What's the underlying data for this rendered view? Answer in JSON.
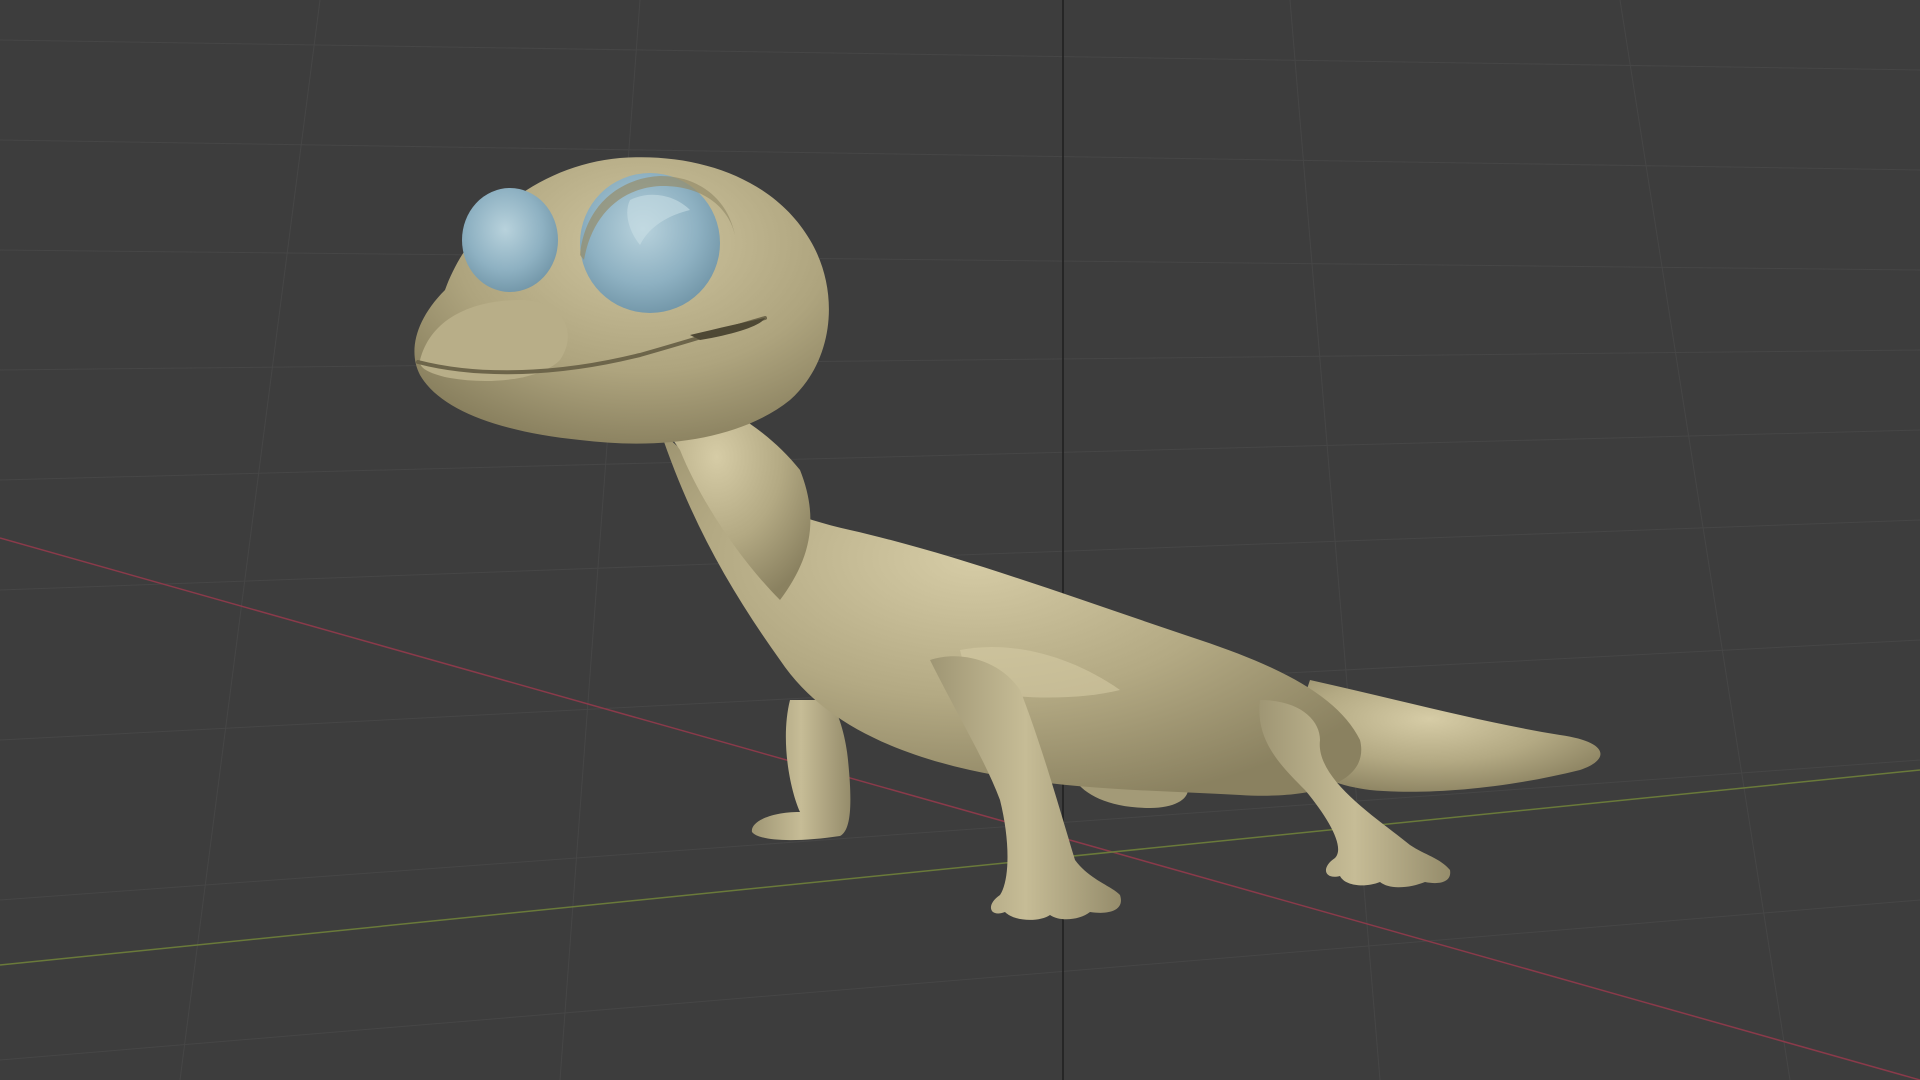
{
  "viewport": {
    "name": "3d-viewport",
    "background_color": "#3d3d3d",
    "grid_line_color": "#464646",
    "x_axis_color": "#8a3a4a",
    "y_axis_color": "#6a7a3a",
    "z_axis_color": "#202020"
  },
  "model": {
    "name": "gecko-model",
    "body_color": "#b5ab86",
    "shadow_color": "#8c8362",
    "highlight_color": "#d8cfaa",
    "eye_color": "#8fb3c4",
    "eye_highlight_color": "#b9d3dd"
  }
}
